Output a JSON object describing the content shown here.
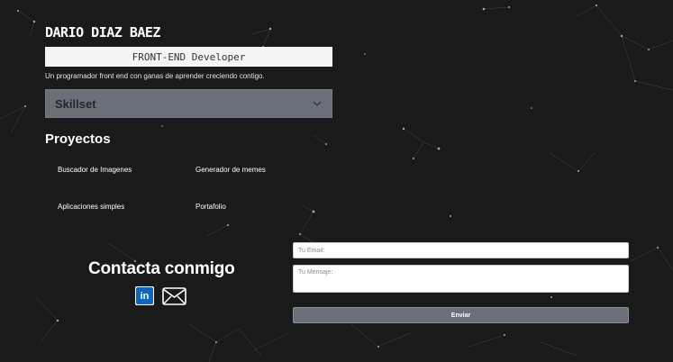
{
  "header": {
    "name": "DARIO DIAZ BAEZ",
    "role": "FRONT-END Developer",
    "tagline": "Un programador front end con ganas de aprender creciendo contigo."
  },
  "skillset": {
    "label": "Skillset",
    "icon": "chevron-down-icon"
  },
  "projects": {
    "title": "Proyectos",
    "items": [
      "Buscador de Imagenes",
      "Generador de memes",
      "Aplicaciones simples",
      "Portafolio"
    ]
  },
  "contact": {
    "title": "Contacta conmigo",
    "linkedin_icon": "linkedin-icon",
    "mail_icon": "mail-icon"
  },
  "form": {
    "email_placeholder": "Tu Email:",
    "message_placeholder": "Tu Mensaje:",
    "send_label": "Enviar"
  },
  "colors": {
    "background": "#1a1a1b",
    "accent": "#6b7078",
    "linkedin": "#0a66c2"
  }
}
